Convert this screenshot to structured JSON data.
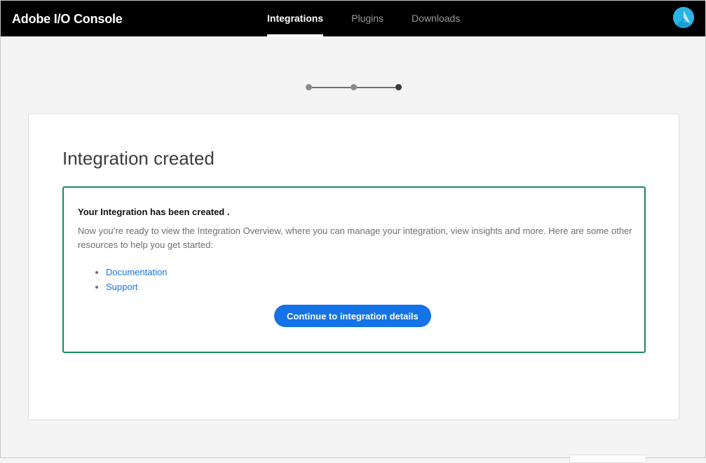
{
  "header": {
    "brand": "Adobe I/O Console",
    "nav": [
      {
        "label": "Integrations",
        "active": true
      },
      {
        "label": "Plugins",
        "active": false
      },
      {
        "label": "Downloads",
        "active": false
      }
    ],
    "avatar_color": "#2ab5e9"
  },
  "stepper": {
    "total_steps": 3,
    "current_step": 3
  },
  "card": {
    "title": "Integration created",
    "success": {
      "heading": "Your Integration has been created .",
      "body": "Now you’re ready to view the Integration Overview, where you can manage your integration, view insights and more. Here are some other resources to help you get started:",
      "links": [
        {
          "label": "Documentation"
        },
        {
          "label": "Support"
        }
      ],
      "button_label": "Continue to integration details",
      "border_color": "#1a8a5a"
    }
  },
  "colors": {
    "accent": "#1473e6",
    "header_bg": "#000000",
    "page_bg": "#f4f4f4"
  }
}
